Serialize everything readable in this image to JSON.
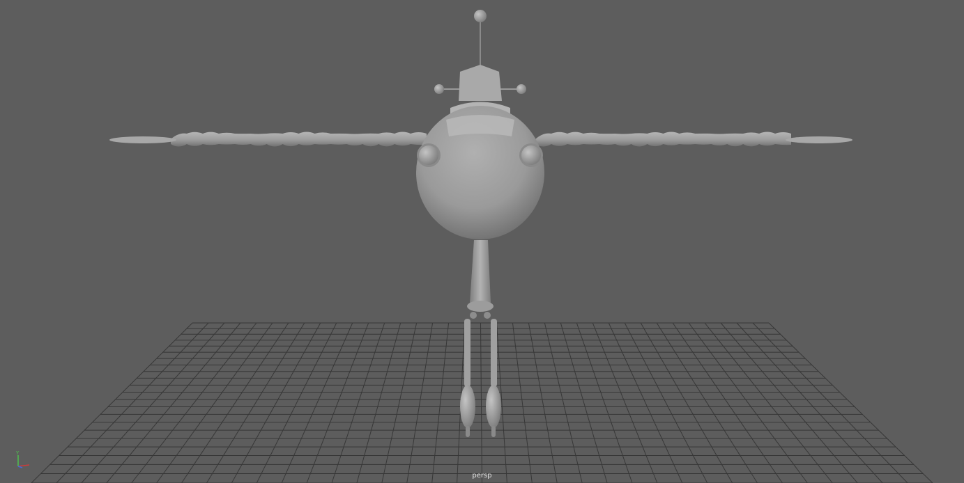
{
  "viewport": {
    "camera_name": "persp",
    "background_color": "#5d5d5d",
    "grid_color": "#373737",
    "model_color": "#a4a4a4",
    "object": "airplane-character-model"
  },
  "axis_gizmo": {
    "labels": [
      "Y",
      "X",
      "Z"
    ],
    "colors": {
      "x": "#d13b3b",
      "y": "#4ec24e",
      "z": "#3d6ce0"
    }
  }
}
